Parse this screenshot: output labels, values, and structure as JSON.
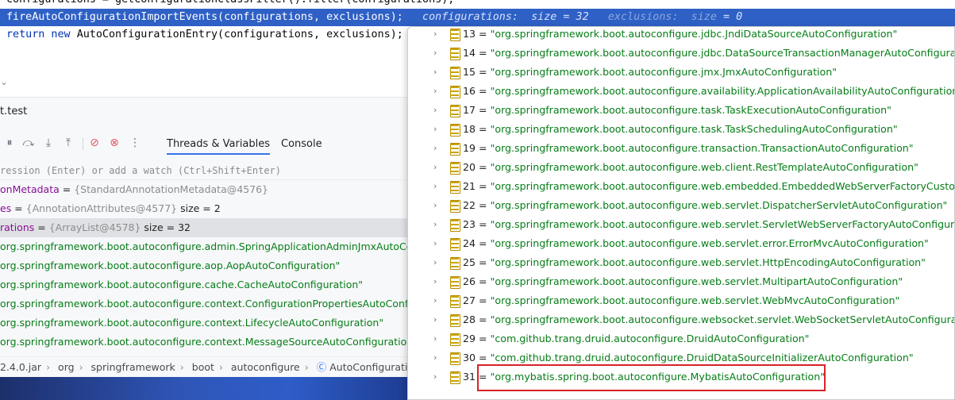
{
  "editor": {
    "line_top": "configurations = getConfigurationClassFilter().filter(configurations);",
    "line_hl": "fireAutoConfigurationImportEvents(configurations, exclusions);",
    "hint_configurations": "configurations:  size = 32",
    "hint_exclusions": "exclusions:  size",
    "hint_exclusions_val": "= 0",
    "line_return_kw": "return new",
    "line_return": "AutoConfigurationEntry(configurations, exclusions);",
    "fold_icon": "chevron-down-icon"
  },
  "debug": {
    "title": "t.test",
    "tabs": [
      "Threads & Variables",
      "Console"
    ],
    "watch_placeholder": "ression (Enter) or add a watch (Ctrl+Shift+Enter)",
    "variables": [
      {
        "name": "onMetadata",
        "eq": " = ",
        "ref": "{StandardAnnotationMetadata@4576}",
        "extra": ""
      },
      {
        "name": "es",
        "eq": " = ",
        "ref": "{AnnotationAttributes@4577}",
        "extra": "  size = 2"
      },
      {
        "name": "rations",
        "eq": " = ",
        "ref": "{ArrayList@4578}",
        "extra": "  size = 32"
      }
    ],
    "items": [
      "org.springframework.boot.autoconfigure.admin.SpringApplicationAdminJmxAutoConfigu",
      "org.springframework.boot.autoconfigure.aop.AopAutoConfiguration\"",
      "org.springframework.boot.autoconfigure.cache.CacheAutoConfiguration\"",
      "org.springframework.boot.autoconfigure.context.ConfigurationPropertiesAutoConfigura",
      "org.springframework.boot.autoconfigure.context.LifecycleAutoConfiguration\"",
      "org.springframework.boot.autoconfigure.context.MessageSourceAutoConfiguration\""
    ],
    "breadcrumb": [
      "2.4.0.jar",
      "org",
      "springframework",
      "boot",
      "autoconfigure",
      "AutoConfiguratio"
    ]
  },
  "popup": {
    "rows": [
      {
        "idx": "13",
        "val": "\"org.springframework.boot.autoconfigure.jdbc.JndiDataSourceAutoConfiguration\""
      },
      {
        "idx": "14",
        "val": "\"org.springframework.boot.autoconfigure.jdbc.DataSourceTransactionManagerAutoConfiguration\""
      },
      {
        "idx": "15",
        "val": "\"org.springframework.boot.autoconfigure.jmx.JmxAutoConfiguration\""
      },
      {
        "idx": "16",
        "val": "\"org.springframework.boot.autoconfigure.availability.ApplicationAvailabilityAutoConfiguration\""
      },
      {
        "idx": "17",
        "val": "\"org.springframework.boot.autoconfigure.task.TaskExecutionAutoConfiguration\""
      },
      {
        "idx": "18",
        "val": "\"org.springframework.boot.autoconfigure.task.TaskSchedulingAutoConfiguration\""
      },
      {
        "idx": "19",
        "val": "\"org.springframework.boot.autoconfigure.transaction.TransactionAutoConfiguration\""
      },
      {
        "idx": "20",
        "val": "\"org.springframework.boot.autoconfigure.web.client.RestTemplateAutoConfiguration\""
      },
      {
        "idx": "21",
        "val": "\"org.springframework.boot.autoconfigure.web.embedded.EmbeddedWebServerFactoryCustomizerAu"
      },
      {
        "idx": "22",
        "val": "\"org.springframework.boot.autoconfigure.web.servlet.DispatcherServletAutoConfiguration\""
      },
      {
        "idx": "23",
        "val": "\"org.springframework.boot.autoconfigure.web.servlet.ServletWebServerFactoryAutoConfiguration\""
      },
      {
        "idx": "24",
        "val": "\"org.springframework.boot.autoconfigure.web.servlet.error.ErrorMvcAutoConfiguration\""
      },
      {
        "idx": "25",
        "val": "\"org.springframework.boot.autoconfigure.web.servlet.HttpEncodingAutoConfiguration\""
      },
      {
        "idx": "26",
        "val": "\"org.springframework.boot.autoconfigure.web.servlet.MultipartAutoConfiguration\""
      },
      {
        "idx": "27",
        "val": "\"org.springframework.boot.autoconfigure.web.servlet.WebMvcAutoConfiguration\""
      },
      {
        "idx": "28",
        "val": "\"org.springframework.boot.autoconfigure.websocket.servlet.WebSocketServletAutoConfiguration\""
      },
      {
        "idx": "29",
        "val": "\"com.github.trang.druid.autoconfigure.DruidAutoConfiguration\""
      },
      {
        "idx": "30",
        "val": "\"com.github.trang.druid.autoconfigure.DruidDataSourceInitializerAutoConfiguration\""
      },
      {
        "idx": "31",
        "val": "\"org.mybatis.spring.boot.autoconfigure.MybatisAutoConfiguration\""
      }
    ],
    "highlight_color": "#d8232a"
  }
}
